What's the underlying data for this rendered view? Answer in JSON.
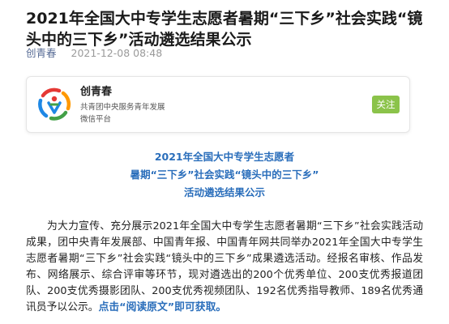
{
  "article": {
    "title": "2021年全国大中专学生志愿者暑期“三下乡”社会实践“镜头中的三下乡”活动遴选结果公示",
    "author": "创青春",
    "date": "2021-12-08 08:48"
  },
  "account_card": {
    "name": "创青春",
    "description": "共青团中央服务青年发展",
    "platform": "微信平台",
    "follow_label": "关注",
    "logo_icon": "chuangqingchun-logo"
  },
  "subtitle": {
    "line1": "2021年全国大中专学生志愿者",
    "line2": "暑期“三下乡”社会实践“镜头中的三下乡”",
    "line3": "活动遴选结果公示"
  },
  "body": {
    "paragraph": "为大力宣传、充分展示2021年全国大中专学生志愿者暑期“三下乡”社会实践活动成果，团中央青年发展部、中国青年报、中国青年网共同举办2021年全国大中专学生志愿者暑期“三下乡”社会实践“镜头中的三下乡”成果遴选活动。经报名审核、作品发布、网络展示、综合评审等环节，现对遴选出的200个优秀单位、200支优秀报道团队、200支优秀摄影团队、200支优秀视频团队、192名优秀指导教师、189名优秀通讯员予以公示。",
    "link_text": "点击“阅读原文”即可获取。"
  },
  "colors": {
    "accent_blue": "#2a6ebb",
    "follow_green": "#8bc34a",
    "author_link": "#576b95"
  }
}
